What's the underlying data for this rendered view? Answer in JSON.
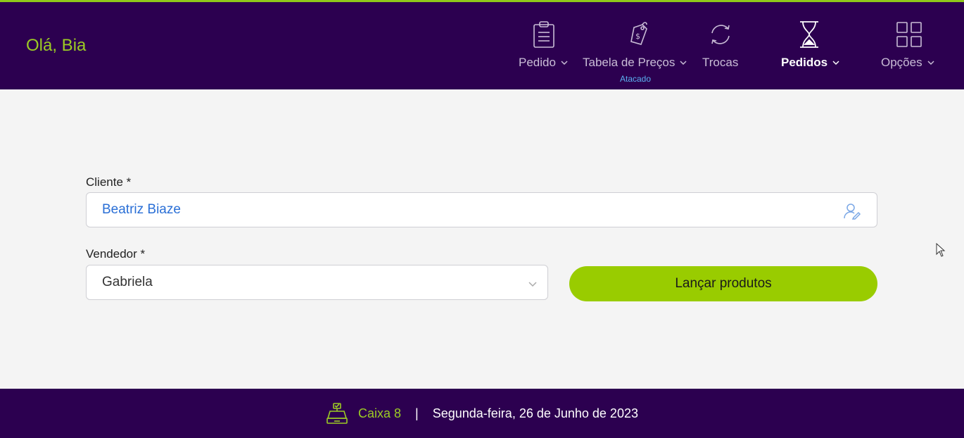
{
  "header": {
    "greeting": "Olá, Bia",
    "nav": [
      {
        "label": "Pedido",
        "icon": "clipboard-icon",
        "has_dropdown": true
      },
      {
        "label": "Tabela de Preços",
        "icon": "price-tag-icon",
        "has_dropdown": true,
        "sub": "Atacado"
      },
      {
        "label": "Trocas",
        "icon": "exchange-icon",
        "has_dropdown": false
      },
      {
        "label": "Pedidos",
        "icon": "hourglass-icon",
        "has_dropdown": true,
        "active": true
      },
      {
        "label": "Opções",
        "icon": "grid-icon",
        "has_dropdown": true
      }
    ]
  },
  "form": {
    "cliente_label": "Cliente *",
    "cliente_value": "Beatriz Biaze",
    "vendedor_label": "Vendedor *",
    "vendedor_value": "Gabriela",
    "launch_label": "Lançar produtos"
  },
  "footer": {
    "caixa": "Caixa 8",
    "separator": "|",
    "date": "Segunda-feira, 26 de Junho de 2023"
  },
  "colors": {
    "header_bg": "#2c0050",
    "accent_green": "#99cc00",
    "link_blue": "#2a6fd6"
  }
}
